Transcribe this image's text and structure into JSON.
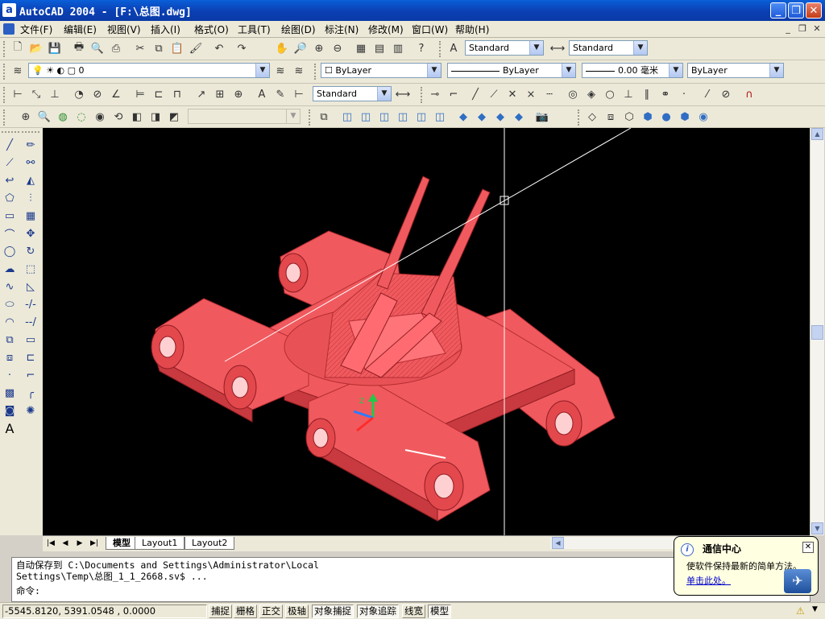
{
  "window": {
    "title": "AutoCAD 2004 - [F:\\总图.dwg]",
    "app_icon": "a"
  },
  "menu": [
    "文件(F)",
    "编辑(E)",
    "视图(V)",
    "插入(I)",
    "格式(O)",
    "工具(T)",
    "绘图(D)",
    "标注(N)",
    "修改(M)",
    "窗口(W)",
    "帮助(H)"
  ],
  "toolbar_standard": {
    "text_style": "Standard",
    "dim_style": "Standard"
  },
  "layers": {
    "current_layer": "0"
  },
  "properties": {
    "color": "ByLayer",
    "linetype": "ByLayer",
    "lineweight": "0.00 毫米",
    "plotstyle": "ByLayer"
  },
  "dimension": {
    "dim_style": "Standard"
  },
  "tabs": [
    "模型",
    "Layout1",
    "Layout2"
  ],
  "command": {
    "history_line1": "自动保存到 C:\\Documents and Settings\\Administrator\\Local",
    "history_line2": "Settings\\Temp\\总图_1_1_2668.sv$ ...",
    "prompt": "命令:"
  },
  "status": {
    "coordinates": "-5545.8120,  5391.0548 , 0.0000",
    "toggles": [
      "捕捉",
      "栅格",
      "正交",
      "极轴",
      "对象捕捉",
      "对象追踪",
      "线宽",
      "模型"
    ],
    "active_toggles": [
      "对象捕捉",
      "对象追踪",
      "模型"
    ]
  },
  "notification": {
    "title": "通信中心",
    "message": "使软件保持最新的简单方法。",
    "link": "单击此处。"
  },
  "colors": {
    "model_red": "#f05a5e",
    "canvas_bg": "#000000",
    "accent_blue": "#0b3fb3"
  }
}
